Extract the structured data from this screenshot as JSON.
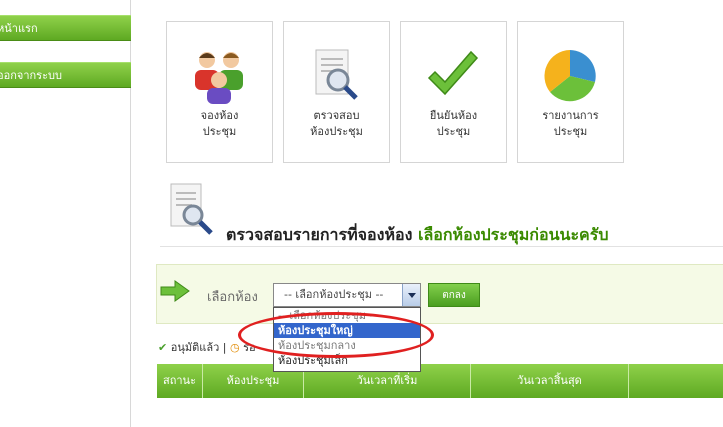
{
  "sidebar": {
    "items": [
      {
        "label": "หน้าแรก"
      },
      {
        "label": "ออกจากระบบ"
      }
    ]
  },
  "tiles": [
    {
      "label": "จองห้อง\nประชุม",
      "icon": "people-icon"
    },
    {
      "label": "ตรวจสอบ\nห้องประชุม",
      "icon": "document-search-icon"
    },
    {
      "label": "ยืนยันห้อง\nประชุม",
      "icon": "checkmark-icon"
    },
    {
      "label": "รายงานการ\nประชุม",
      "icon": "pie-chart-icon"
    }
  ],
  "heading": {
    "title": "ตรวจสอบรายการที่จองห้อง",
    "hint": "เลือกห้องประชุมก่อนนะครับ"
  },
  "room_select": {
    "label": "เลือกห้อง",
    "value": "-- เลือกห้องประชุม --",
    "ok_label": "ตกลง",
    "options": [
      {
        "label": "-- เลือกห้องประชุม --",
        "selected": false
      },
      {
        "label": "ห้องประชุมใหญ่",
        "selected": true
      },
      {
        "label": "ห้องประชุมกลาง",
        "selected": false
      },
      {
        "label": "ห้องประชุมเล็ก",
        "selected": false
      }
    ]
  },
  "legend": {
    "approved": "อนุมัติแล้ว |",
    "pending": "รอ"
  },
  "table": {
    "columns": [
      "สถานะ",
      "ห้องประชุม",
      "วันเวลาที่เริ่ม",
      "วันเวลาสิ้นสุด",
      ""
    ]
  },
  "colors": {
    "accent_green": "#5ea922",
    "hint_green": "#3a8a00",
    "annotation_red": "#e02020",
    "selected_blue": "#3366cc"
  }
}
